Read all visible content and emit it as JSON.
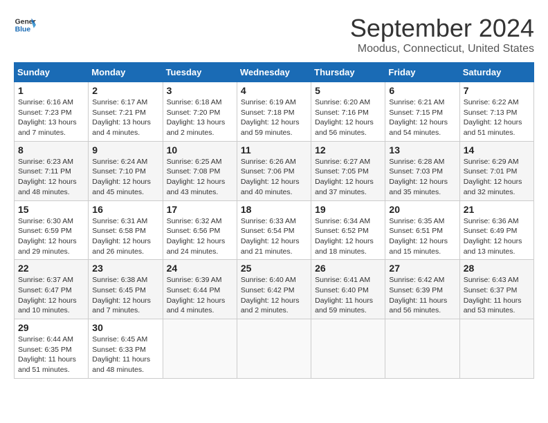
{
  "logo": {
    "line1": "General",
    "line2": "Blue"
  },
  "title": "September 2024",
  "subtitle": "Moodus, Connecticut, United States",
  "days_of_week": [
    "Sunday",
    "Monday",
    "Tuesday",
    "Wednesday",
    "Thursday",
    "Friday",
    "Saturday"
  ],
  "weeks": [
    [
      {
        "day": "1",
        "info": "Sunrise: 6:16 AM\nSunset: 7:23 PM\nDaylight: 13 hours\nand 7 minutes."
      },
      {
        "day": "2",
        "info": "Sunrise: 6:17 AM\nSunset: 7:21 PM\nDaylight: 13 hours\nand 4 minutes."
      },
      {
        "day": "3",
        "info": "Sunrise: 6:18 AM\nSunset: 7:20 PM\nDaylight: 13 hours\nand 2 minutes."
      },
      {
        "day": "4",
        "info": "Sunrise: 6:19 AM\nSunset: 7:18 PM\nDaylight: 12 hours\nand 59 minutes."
      },
      {
        "day": "5",
        "info": "Sunrise: 6:20 AM\nSunset: 7:16 PM\nDaylight: 12 hours\nand 56 minutes."
      },
      {
        "day": "6",
        "info": "Sunrise: 6:21 AM\nSunset: 7:15 PM\nDaylight: 12 hours\nand 54 minutes."
      },
      {
        "day": "7",
        "info": "Sunrise: 6:22 AM\nSunset: 7:13 PM\nDaylight: 12 hours\nand 51 minutes."
      }
    ],
    [
      {
        "day": "8",
        "info": "Sunrise: 6:23 AM\nSunset: 7:11 PM\nDaylight: 12 hours\nand 48 minutes."
      },
      {
        "day": "9",
        "info": "Sunrise: 6:24 AM\nSunset: 7:10 PM\nDaylight: 12 hours\nand 45 minutes."
      },
      {
        "day": "10",
        "info": "Sunrise: 6:25 AM\nSunset: 7:08 PM\nDaylight: 12 hours\nand 43 minutes."
      },
      {
        "day": "11",
        "info": "Sunrise: 6:26 AM\nSunset: 7:06 PM\nDaylight: 12 hours\nand 40 minutes."
      },
      {
        "day": "12",
        "info": "Sunrise: 6:27 AM\nSunset: 7:05 PM\nDaylight: 12 hours\nand 37 minutes."
      },
      {
        "day": "13",
        "info": "Sunrise: 6:28 AM\nSunset: 7:03 PM\nDaylight: 12 hours\nand 35 minutes."
      },
      {
        "day": "14",
        "info": "Sunrise: 6:29 AM\nSunset: 7:01 PM\nDaylight: 12 hours\nand 32 minutes."
      }
    ],
    [
      {
        "day": "15",
        "info": "Sunrise: 6:30 AM\nSunset: 6:59 PM\nDaylight: 12 hours\nand 29 minutes."
      },
      {
        "day": "16",
        "info": "Sunrise: 6:31 AM\nSunset: 6:58 PM\nDaylight: 12 hours\nand 26 minutes."
      },
      {
        "day": "17",
        "info": "Sunrise: 6:32 AM\nSunset: 6:56 PM\nDaylight: 12 hours\nand 24 minutes."
      },
      {
        "day": "18",
        "info": "Sunrise: 6:33 AM\nSunset: 6:54 PM\nDaylight: 12 hours\nand 21 minutes."
      },
      {
        "day": "19",
        "info": "Sunrise: 6:34 AM\nSunset: 6:52 PM\nDaylight: 12 hours\nand 18 minutes."
      },
      {
        "day": "20",
        "info": "Sunrise: 6:35 AM\nSunset: 6:51 PM\nDaylight: 12 hours\nand 15 minutes."
      },
      {
        "day": "21",
        "info": "Sunrise: 6:36 AM\nSunset: 6:49 PM\nDaylight: 12 hours\nand 13 minutes."
      }
    ],
    [
      {
        "day": "22",
        "info": "Sunrise: 6:37 AM\nSunset: 6:47 PM\nDaylight: 12 hours\nand 10 minutes."
      },
      {
        "day": "23",
        "info": "Sunrise: 6:38 AM\nSunset: 6:45 PM\nDaylight: 12 hours\nand 7 minutes."
      },
      {
        "day": "24",
        "info": "Sunrise: 6:39 AM\nSunset: 6:44 PM\nDaylight: 12 hours\nand 4 minutes."
      },
      {
        "day": "25",
        "info": "Sunrise: 6:40 AM\nSunset: 6:42 PM\nDaylight: 12 hours\nand 2 minutes."
      },
      {
        "day": "26",
        "info": "Sunrise: 6:41 AM\nSunset: 6:40 PM\nDaylight: 11 hours\nand 59 minutes."
      },
      {
        "day": "27",
        "info": "Sunrise: 6:42 AM\nSunset: 6:39 PM\nDaylight: 11 hours\nand 56 minutes."
      },
      {
        "day": "28",
        "info": "Sunrise: 6:43 AM\nSunset: 6:37 PM\nDaylight: 11 hours\nand 53 minutes."
      }
    ],
    [
      {
        "day": "29",
        "info": "Sunrise: 6:44 AM\nSunset: 6:35 PM\nDaylight: 11 hours\nand 51 minutes."
      },
      {
        "day": "30",
        "info": "Sunrise: 6:45 AM\nSunset: 6:33 PM\nDaylight: 11 hours\nand 48 minutes."
      },
      {
        "day": "",
        "info": ""
      },
      {
        "day": "",
        "info": ""
      },
      {
        "day": "",
        "info": ""
      },
      {
        "day": "",
        "info": ""
      },
      {
        "day": "",
        "info": ""
      }
    ]
  ]
}
